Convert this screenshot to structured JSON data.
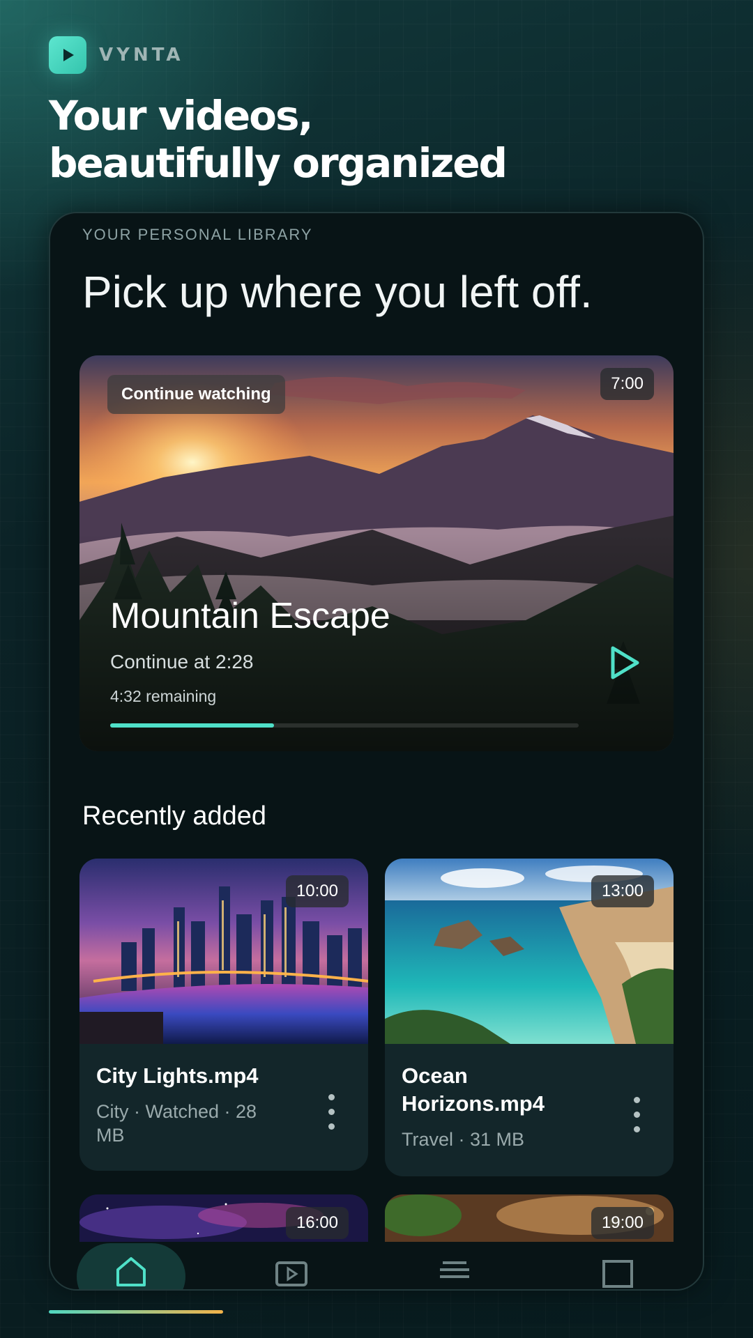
{
  "brand": {
    "name": "VYNTA",
    "logo_icon": "play-icon",
    "accent": "#4fe0c8"
  },
  "headline": {
    "line1": "Your videos,",
    "line2": "beautifully organized"
  },
  "library": {
    "label": "YOUR PERSONAL LIBRARY",
    "title": "Pick up where you left off."
  },
  "hero": {
    "badge": "Continue watching",
    "duration": "7:00",
    "title": "Mountain Escape",
    "continue_at": "Continue at 2:28",
    "remaining": "4:32 remaining",
    "progress": 0.35,
    "play_icon": "play-icon"
  },
  "recent": {
    "title": "Recently added",
    "items": [
      {
        "duration": "10:00",
        "name": "City Lights.mp4",
        "meta": "City · Watched · 28 MB"
      },
      {
        "duration": "13:00",
        "name": "Ocean Horizons.mp4",
        "meta": "Travel · 31 MB"
      },
      {
        "duration": "16:00"
      },
      {
        "duration": "19:00"
      }
    ]
  },
  "nav": {
    "items": [
      {
        "icon": "home-icon",
        "active": true
      },
      {
        "icon": "video-icon",
        "active": false
      },
      {
        "icon": "list-icon",
        "active": false
      },
      {
        "icon": "square-icon",
        "active": false
      }
    ]
  }
}
